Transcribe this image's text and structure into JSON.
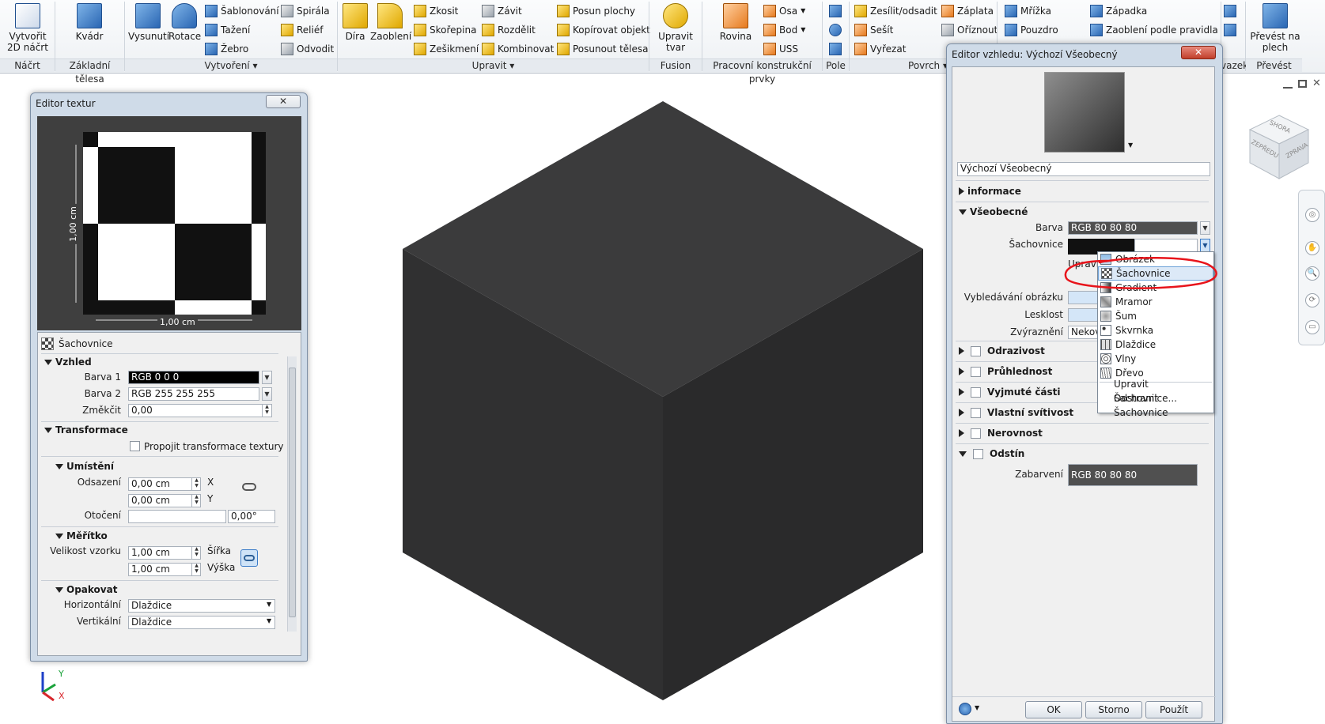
{
  "ribbon": {
    "groups": [
      {
        "label": "Náčrt"
      },
      {
        "label": "Základní tělesa"
      },
      {
        "label": "Vytvoření ▾"
      },
      {
        "label": "Upravit ▾"
      },
      {
        "label": "Fusion"
      },
      {
        "label": "Pracovní konstrukční prvky"
      },
      {
        "label": "Pole"
      },
      {
        "label": "Povrch ▾"
      },
      {
        "label": "vazek"
      },
      {
        "label": "Převést"
      }
    ],
    "buttons": {
      "create_sketch": "Vytvořit\n2D náčrt",
      "box": "Kvádr",
      "extrude": "Vysunutí",
      "revolve": "Rotace",
      "loft": "Šablonování",
      "sweep": "Tažení",
      "rib": "Žebro",
      "coil": "Spirála",
      "emboss": "Reliéf",
      "derive": "Odvodit",
      "hole": "Díra",
      "fillet": "Zaoblení",
      "chamfer": "Zkosit",
      "shell": "Skořepina",
      "draft": "Zešikmení",
      "thread": "Závit",
      "split": "Rozdělit",
      "combine": "Kombinovat",
      "move_face": "Posun plochy",
      "copy_object": "Kopírovat objekt",
      "move_bodies": "Posunout tělesa",
      "edit_form": "Upravit\ntvar",
      "plane": "Rovina",
      "axis": "Osa",
      "point": "Bod",
      "ucs": "USS",
      "thicken": "Zesílit/odsadit",
      "stitch": "Sešít",
      "sculpt": "Vyřezat",
      "patch": "Záplata",
      "trim": "Oříznout",
      "grid": "Mřížka",
      "boundary": "Pouzdro",
      "snap": "Západka",
      "rule_fillet": "Zaoblení podle pravidla",
      "convert_sheet": "Převést na\nplech"
    }
  },
  "texture_editor": {
    "title": "Editor textur",
    "dim_h": "1,00 cm",
    "dim_v": "1,00 cm",
    "type_label": "Šachovnice",
    "sec_look": "Vzhled",
    "color1_label": "Barva 1",
    "color1_value": "RGB 0 0 0",
    "color2_label": "Barva 2",
    "color2_value": "RGB 255 255 255",
    "soften_label": "Změkčit",
    "soften_value": "0,00",
    "sec_transform": "Transformace",
    "link_transforms": "Propojit transformace textury",
    "sec_position": "Umístění",
    "offset_label": "Odsazení",
    "offset_x": "0,00 cm",
    "offset_y": "0,00 cm",
    "axis_x": "X",
    "axis_y": "Y",
    "rotation_label": "Otočení",
    "rotation_value": "0,00°",
    "sec_scale": "Měřítko",
    "sample_size_label": "Velikost vzorku",
    "width_value": "1,00 cm",
    "height_value": "1,00 cm",
    "width_label": "Šířka",
    "height_label": "Výška",
    "sec_repeat": "Opakovat",
    "horizontal_label": "Horizontální",
    "horizontal_value": "Dlaždice",
    "vertical_label": "Vertikální",
    "vertical_value": "Dlaždice"
  },
  "appearance_editor": {
    "title": "Editor vzhledu: Výchozí Všeobecný",
    "name_value": "Výchozí Všeobecný",
    "sec_info": "informace",
    "sec_general": "Všeobecné",
    "color_label": "Barva",
    "color_value": "RGB 80 80 80",
    "checker_label": "Šachovnice",
    "edit_partial": "Upravit",
    "fade_label": "Vybledávání obrázku",
    "gloss_label": "Lesklost",
    "highlight_label": "Zvýraznění",
    "highlight_value": "Nekov",
    "sec_reflect": "Odrazivost",
    "sec_transp": "Průhlednost",
    "sec_cutout": "Vyjmuté části",
    "sec_selfillum": "Vlastní svítivost",
    "sec_bump": "Nerovnost",
    "sec_tint": "Odstín",
    "tint_label": "Zabarvení",
    "tint_value": "RGB 80 80 80",
    "ok": "OK",
    "cancel": "Storno",
    "apply": "Použít"
  },
  "dropdown_menu": {
    "items": [
      "Obrázek",
      "Šachovnice",
      "Gradient",
      "Mramor",
      "Šum",
      "Skvrnka",
      "Dlaždice",
      "Vlny",
      "Dřevo"
    ],
    "selected": "Šachovnice",
    "edit_item": "Upravit Šachovnice...",
    "remove_item": "Odstranit Šachovnice"
  },
  "viewcube": {
    "top": "SHORA",
    "front": "ZEPŘEDU",
    "right": "ZPRAVA"
  },
  "triad": {
    "x": "X",
    "y": "Y"
  },
  "colors": {
    "cube_top": "#3b3b3c",
    "cube_left": "#2f2f30",
    "cube_right": "#2a2a2b",
    "annotation": "#e8141b"
  }
}
